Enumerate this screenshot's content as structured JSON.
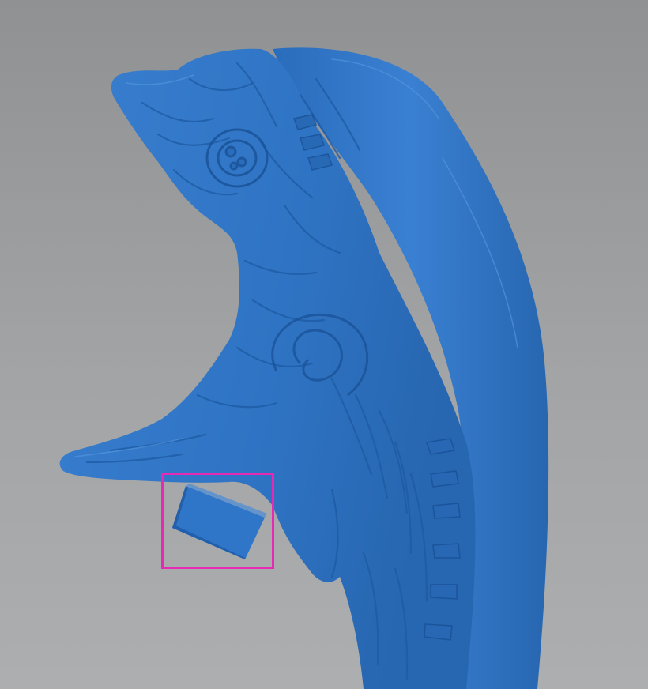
{
  "viewport": {
    "model": "sculpted-organic-mesh",
    "support": "cube-support-block"
  },
  "colors": {
    "background_top": "#8f9193",
    "background_bottom": "#acaeb0",
    "mesh": "#2f74c4",
    "mesh_shadow": "#1d5aa3",
    "mesh_highlight": "#4a8bd8",
    "selection": "#e62ab4"
  },
  "selection": {
    "target": "cube-support-block"
  }
}
